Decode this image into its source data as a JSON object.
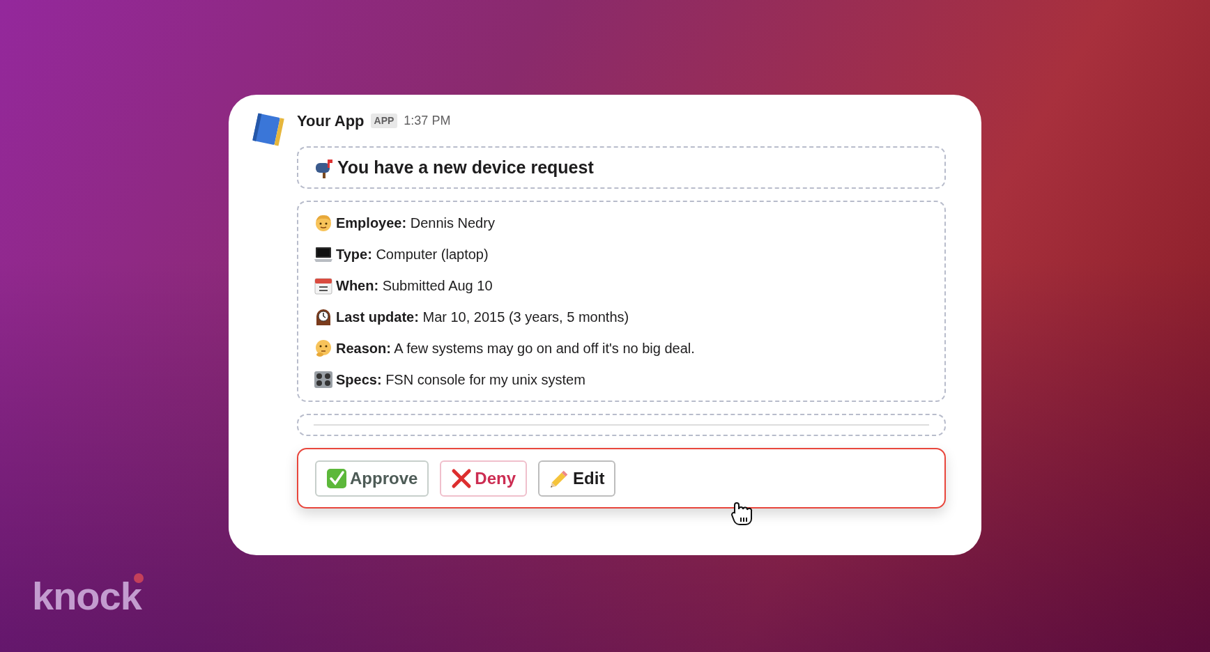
{
  "message": {
    "sender": "Your App",
    "badge": "APP",
    "time": "1:37 PM",
    "header": "You have a new device request",
    "fields": [
      {
        "kind": "person",
        "label": "Employee:",
        "value": "Dennis Nedry"
      },
      {
        "kind": "laptop",
        "label": "Type:",
        "value": "Computer (laptop)"
      },
      {
        "kind": "calendar",
        "label": "When:",
        "value": "Submitted Aug 10"
      },
      {
        "kind": "clock",
        "label": "Last update:",
        "value": "Mar 10, 2015 (3 years, 5 months)"
      },
      {
        "kind": "thinking",
        "label": "Reason:",
        "value": "A few systems may go on and off it's no big deal."
      },
      {
        "kind": "knobs",
        "label": "Specs:",
        "value": "FSN console for my unix system"
      }
    ],
    "actions": [
      {
        "kind": "approve",
        "label": "Approve"
      },
      {
        "kind": "deny",
        "label": "Deny"
      },
      {
        "kind": "edit",
        "label": "Edit"
      }
    ]
  },
  "brand": {
    "logo": "knock"
  }
}
